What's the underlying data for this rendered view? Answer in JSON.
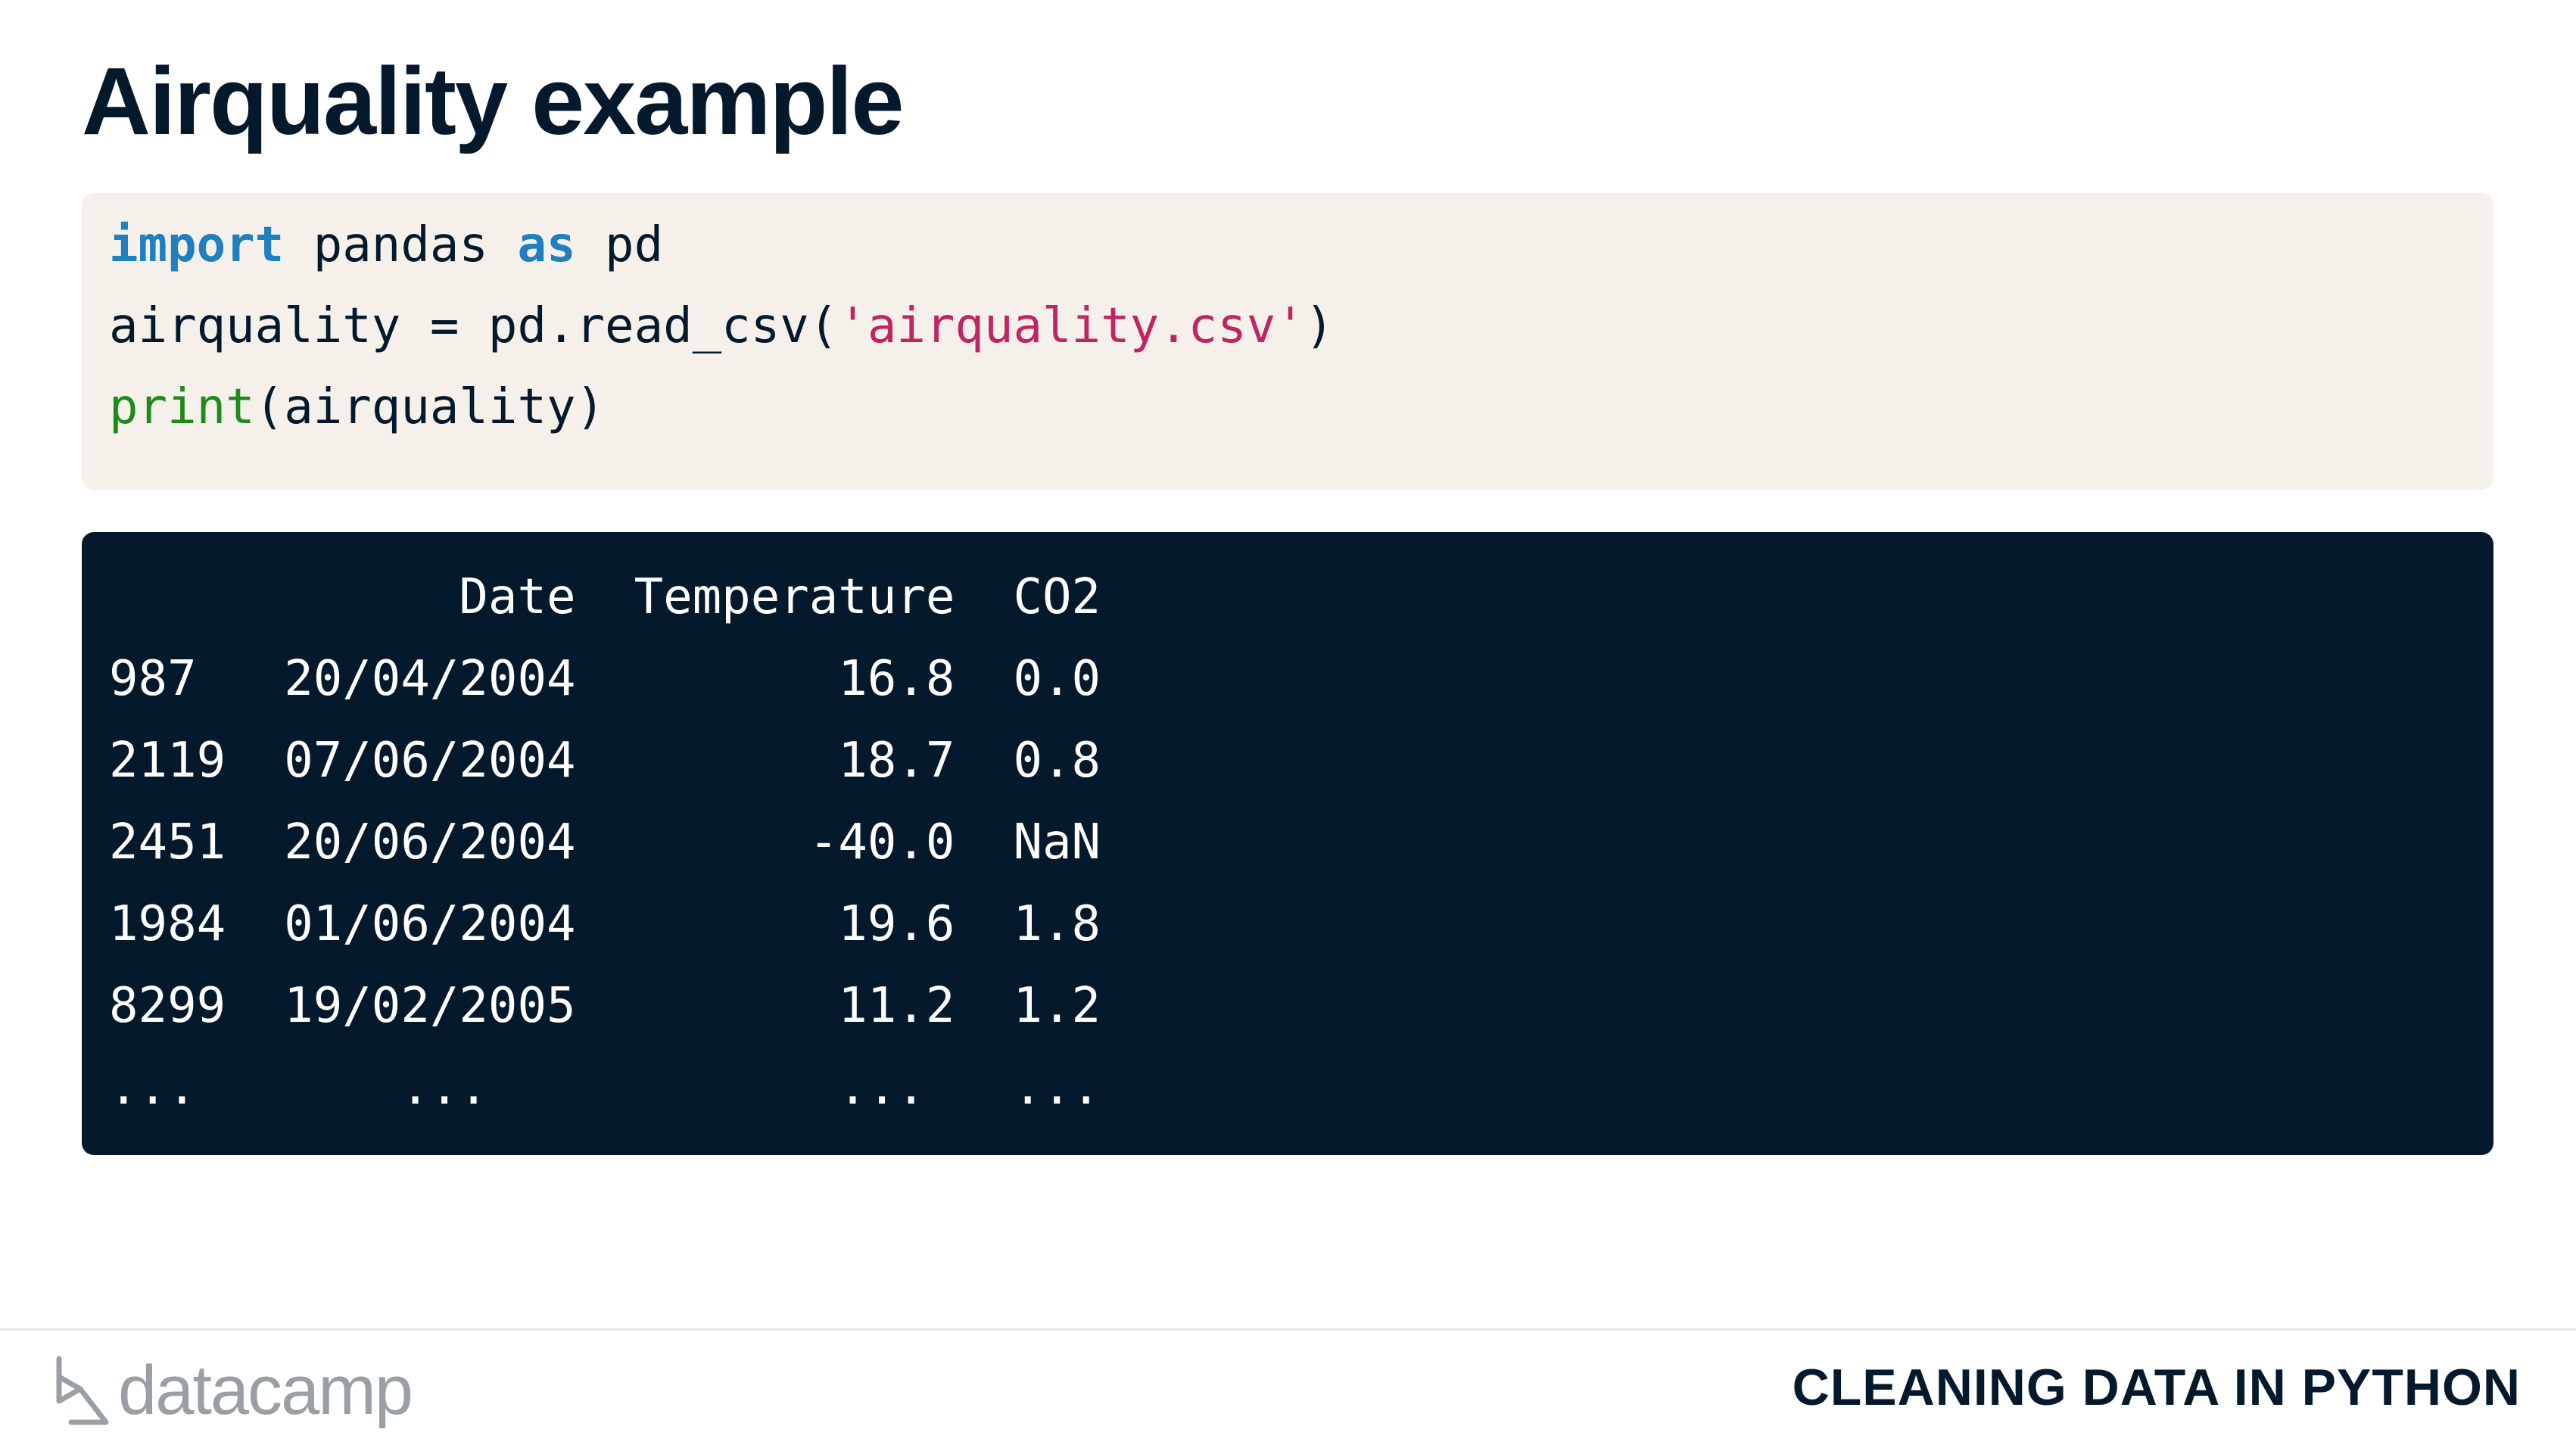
{
  "slide": {
    "title": "Airquality example"
  },
  "code": {
    "kw_import": "import",
    "module": " pandas ",
    "kw_as": "as",
    "alias": " pd",
    "line2_prefix": "airquality = pd.read_csv(",
    "line2_string": "'airquality.csv'",
    "line2_suffix": ")",
    "fn_print": "print",
    "line3_suffix": "(airquality)"
  },
  "output": {
    "lines": [
      "            Date  Temperature  CO2",
      "987   20/04/2004         16.8  0.0",
      "2119  07/06/2004         18.7  0.8",
      "2451  20/06/2004        -40.0  NaN",
      "1984  01/06/2004         19.6  1.8",
      "8299  19/02/2005         11.2  1.2",
      "...       ...            ...   ..."
    ]
  },
  "footer": {
    "logo_text": "datacamp",
    "logo_icon": "datacamp-logo-icon",
    "course_name": "CLEANING DATA IN PYTHON"
  },
  "colors": {
    "title": "#05192d",
    "code_background": "#f5f1ea",
    "output_background": "#05192d",
    "keyword": "#1f7fbf",
    "string": "#c02462",
    "builtin": "#1e8a1e"
  }
}
